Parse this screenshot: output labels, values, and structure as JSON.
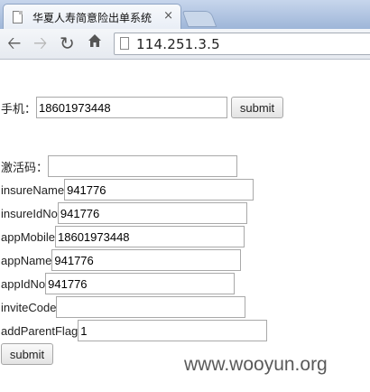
{
  "browser": {
    "tab_title": "华夏人寿简意险出单系统",
    "tab_close": "×",
    "url": "114.251.3.5"
  },
  "icons": {
    "back": "back-arrow-icon",
    "forward": "forward-arrow-icon",
    "reload": "reload-icon",
    "home": "home-icon"
  },
  "form1": {
    "phone_label": "手机：",
    "phone_value": "18601973448",
    "submit_label": "submit"
  },
  "form2": {
    "activation_label": "激活码：",
    "activation_value": "",
    "fields": [
      {
        "label": "insureName",
        "value": "941776"
      },
      {
        "label": "insureIdNo",
        "value": "941776"
      },
      {
        "label": "appMobile",
        "value": "18601973448"
      },
      {
        "label": "appName",
        "value": "941776"
      },
      {
        "label": "appIdNo",
        "value": "941776"
      },
      {
        "label": "inviteCode",
        "value": ""
      },
      {
        "label": "addParentFlag",
        "value": "1"
      }
    ],
    "submit_label": "submit"
  },
  "watermark": "www.wooyun.org"
}
